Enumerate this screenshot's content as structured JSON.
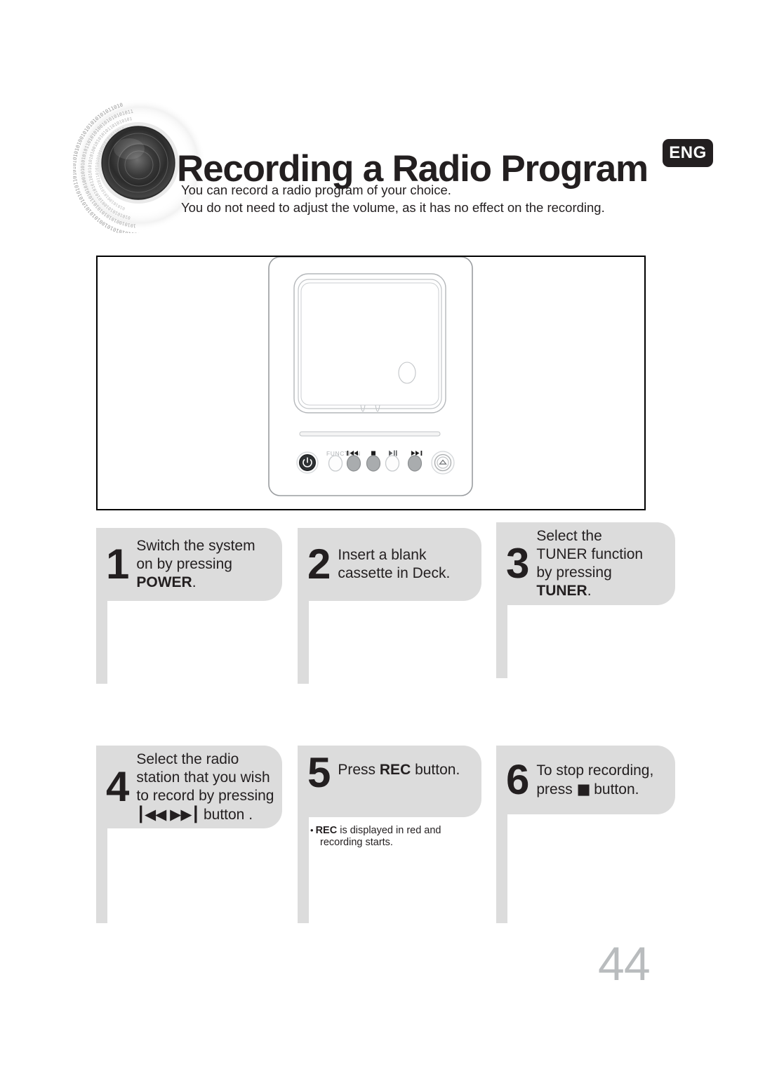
{
  "header": {
    "title": "Recording a Radio Program",
    "lang_badge": "ENG",
    "intro_line_1": "You can record a radio program of your choice.",
    "intro_line_2": "You do not need to adjust the volume, as it has no effect on the recording.",
    "speaker_icon": "speaker-binary-circle-icon"
  },
  "illustration": {
    "name": "product-front-panel-illustration",
    "panel_label_function": "FUNCTION",
    "buttons": [
      {
        "name": "power-button",
        "glyph": "power-symbol"
      },
      {
        "name": "function-button",
        "glyph": "blank"
      },
      {
        "name": "previous-button",
        "glyph": "skip-backward"
      },
      {
        "name": "stop-button",
        "glyph": "stop-square"
      },
      {
        "name": "play-pause-button",
        "glyph": "play-pause"
      },
      {
        "name": "next-button",
        "glyph": "skip-forward"
      },
      {
        "name": "eject-button",
        "glyph": "eject-triangle"
      }
    ]
  },
  "steps": [
    {
      "number": "1",
      "lines": [
        "Switch the system",
        "on by pressing",
        "POWER."
      ],
      "bold_last": "POWER",
      "tail_suffix": "."
    },
    {
      "number": "2",
      "lines": [
        "Insert a blank",
        "cassette in Deck."
      ]
    },
    {
      "number": "3",
      "lines": [
        "Select the",
        "TUNER function",
        "by pressing",
        "TUNER."
      ],
      "bold_last": "TUNER",
      "tail_suffix": "."
    },
    {
      "number": "4",
      "lines": [
        "Select the radio",
        "station that you wish",
        "to record by pressing",
        "button ."
      ],
      "glyph_prev": "┃◀◀",
      "glyph_next": "▶▶┃"
    },
    {
      "number": "5",
      "text_before": "Press ",
      "text_bold": "REC",
      "text_after": " button.",
      "note_bold": "REC",
      "note_line_1": " is displayed in red and",
      "note_line_2": "recording starts.",
      "note_bullet": "•"
    },
    {
      "number": "6",
      "line_1": "To stop recording,",
      "line_2_before": "press ",
      "line_2_glyph": "■",
      "line_2_after": " button."
    }
  ],
  "footer": {
    "page_number": "44"
  },
  "colors": {
    "step_box": "#dcdcdc",
    "badge": "#231f20",
    "text": "#231f20",
    "page_number": "#b9bcbe"
  }
}
